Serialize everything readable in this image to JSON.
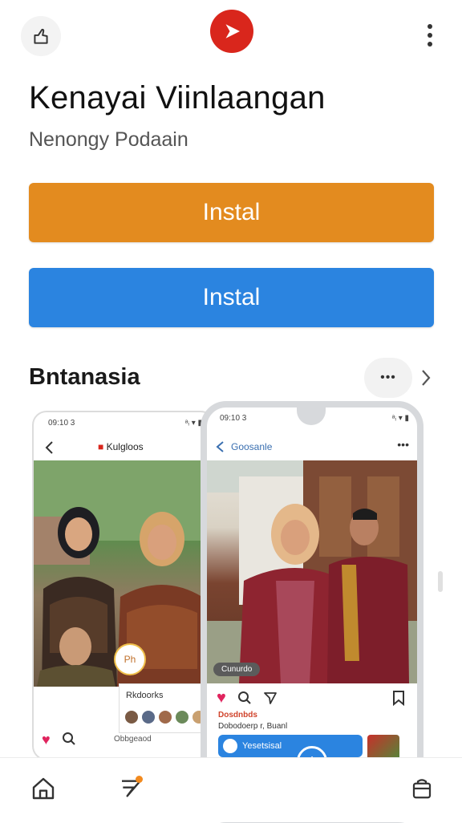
{
  "app": {
    "title": "Kenayai Viinlaangan",
    "developer": "Nenongy Podaain",
    "install_primary": "Instal",
    "install_secondary": "Instal",
    "brand_color": "#d9261c"
  },
  "colors": {
    "orange_button": "#e38b1f",
    "blue_button": "#2b84e0"
  },
  "section": {
    "title": "Bntanasia",
    "more_label": "•••"
  },
  "screenshots": {
    "left": {
      "status_time": "09:10 3",
      "status_right": "ᵃᵢ ▾ ▮",
      "title": "Kulgloos",
      "caption": "Rkdoorks",
      "badge": "Ph",
      "handle": "Obbgeaod"
    },
    "right": {
      "status_time": "09:10 3",
      "status_right": "ᵃᵢ ▾ ▮",
      "title": "Goosanle",
      "more": "•••",
      "tag": "Cunurdo",
      "brand": "Dosdnbds",
      "desc": "Dobodoerp r, Buanl",
      "comment": "Yesetsisal",
      "fab": "+"
    }
  },
  "icons": [
    "share-icon",
    "play-logo-icon",
    "more-vert-icon",
    "chevron-right-icon",
    "home-icon",
    "apps-icon",
    "shopping-bag-icon",
    "heart-icon",
    "search-icon",
    "send-icon",
    "bookmark-icon"
  ]
}
